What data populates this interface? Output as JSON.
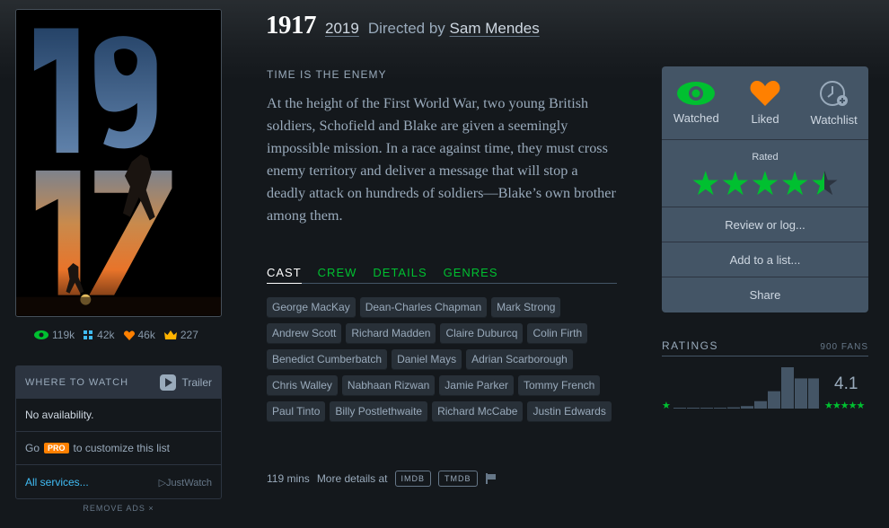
{
  "film": {
    "title": "1917",
    "year": "2019",
    "directed_by_label": "Directed by",
    "director": "Sam Mendes",
    "tagline": "TIME IS THE ENEMY",
    "synopsis": "At the height of the First World War, two young British soldiers, Schofield and Blake are given a seemingly impossible mission. In a race against time, they must cross enemy territory and deliver a message that will stop a deadly attack on hundreds of soldiers—Blake’s own brother among them."
  },
  "stats": {
    "watched": "119k",
    "lists": "42k",
    "likes": "46k",
    "top": "227"
  },
  "where_to_watch": {
    "title": "WHERE TO WATCH",
    "trailer": "Trailer",
    "availability": "No availability.",
    "go_prefix": "Go",
    "pro_badge": "PRO",
    "go_suffix": "to customize this list",
    "all_services": "All services...",
    "justwatch": "JustWatch"
  },
  "remove_ads": "REMOVE ADS",
  "tabs": [
    "CAST",
    "CREW",
    "DETAILS",
    "GENRES"
  ],
  "cast": [
    "George MacKay",
    "Dean-Charles Chapman",
    "Mark Strong",
    "Andrew Scott",
    "Richard Madden",
    "Claire Duburcq",
    "Colin Firth",
    "Benedict Cumberbatch",
    "Daniel Mays",
    "Adrian Scarborough",
    "Chris Walley",
    "Nabhaan Rizwan",
    "Jamie Parker",
    "Tommy French",
    "Paul Tinto",
    "Billy Postlethwaite",
    "Richard McCabe",
    "Justin Edwards"
  ],
  "footer": {
    "runtime": "119 mins",
    "more_details": "More details at",
    "imdb": "IMDB",
    "tmdb": "TMDB"
  },
  "panel": {
    "watched": "Watched",
    "liked": "Liked",
    "watchlist": "Watchlist",
    "rated": "Rated",
    "rating_stars": 4.5,
    "review": "Review or log...",
    "add_list": "Add to a list...",
    "share": "Share"
  },
  "ratings": {
    "title": "RATINGS",
    "fans": "900 FANS",
    "average": "4.1",
    "histogram": [
      0.01,
      0.01,
      0.02,
      0.02,
      0.03,
      0.06,
      0.18,
      0.42,
      1.0,
      0.73,
      0.73
    ],
    "low_star": "★",
    "high_stars": "★★★★★"
  },
  "colors": {
    "green": "#00c030",
    "orange": "#ff8000",
    "blue": "#40bcf4",
    "panel": "#445566"
  }
}
